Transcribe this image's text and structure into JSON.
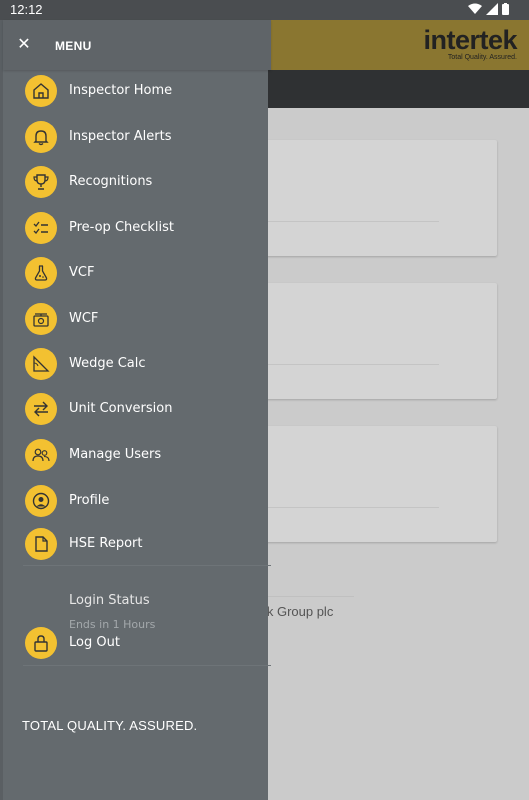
{
  "status_bar": {
    "time": "12:12"
  },
  "app": {
    "brand": {
      "logo": "intertek",
      "tagline": "Total Quality. Assured."
    },
    "footer_text": "tek Group plc"
  },
  "drawer": {
    "title": "MENU",
    "items": [
      {
        "label": "Inspector Home",
        "icon": "home-icon"
      },
      {
        "label": "Inspector Alerts",
        "icon": "bell-icon"
      },
      {
        "label": "Recognitions",
        "icon": "trophy-icon"
      },
      {
        "label": "Pre-op Checklist",
        "icon": "checklist-icon"
      },
      {
        "label": "VCF",
        "icon": "flask-icon"
      },
      {
        "label": "WCF",
        "icon": "scale-icon"
      },
      {
        "label": "Wedge Calc",
        "icon": "wedge-icon"
      },
      {
        "label": "Unit Conversion",
        "icon": "swap-arrows-icon"
      },
      {
        "label": "Manage Users",
        "icon": "users-icon"
      },
      {
        "label": "Profile",
        "icon": "profile-icon"
      },
      {
        "label": "HSE Report",
        "icon": "document-icon"
      }
    ],
    "login_status": {
      "label": "Login Status",
      "detail": "Ends in 1 Hours"
    },
    "logout": {
      "label": "Log Out",
      "icon": "lock-icon"
    },
    "footer_tagline": "TOTAL QUALITY. ASSURED."
  },
  "colors": {
    "accent": "#f3c131",
    "drawer_bg": "#646a6e",
    "header_gold": "#8a7630"
  }
}
